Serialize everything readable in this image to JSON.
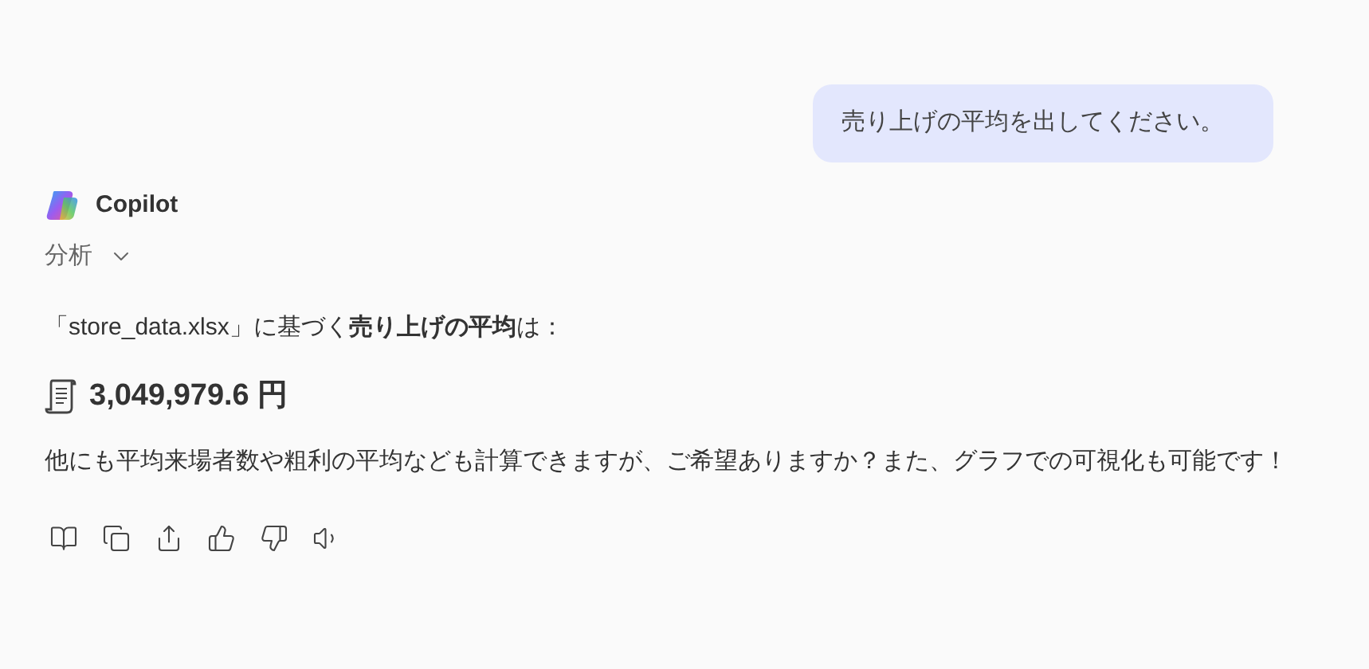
{
  "user_message": {
    "text": "売り上げの平均を出してください。"
  },
  "assistant": {
    "name": "Copilot",
    "analysis": {
      "label": "分析",
      "expanded": false
    },
    "intro": "「store_data.xlsx」に基づく**売り上げの平均**は：",
    "result": "3,049,979.6 円",
    "followup": "他にも平均来場者数や粗利の平均なども計算できますが、ご希望ありますか？また、グラフでの可視化も可能です！"
  },
  "actions": [
    {
      "kind": "pages"
    },
    {
      "kind": "copy"
    },
    {
      "kind": "share"
    },
    {
      "kind": "like"
    },
    {
      "kind": "dislike"
    },
    {
      "kind": "read-aloud"
    }
  ]
}
